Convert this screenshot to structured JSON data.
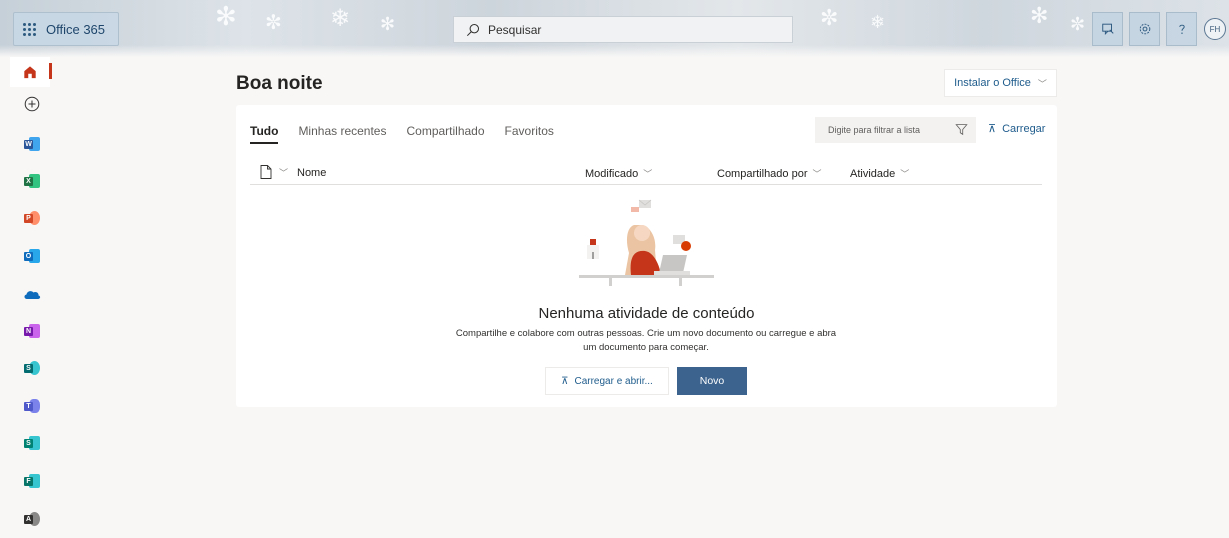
{
  "topbar": {
    "app_title": "Office 365",
    "search_placeholder": "Pesquisar",
    "avatar_initials": "FH"
  },
  "rail": {
    "items": [
      {
        "name": "home",
        "letter": "",
        "color": "#c4351a"
      },
      {
        "name": "create",
        "letter": "",
        "color": "#323130"
      },
      {
        "name": "word",
        "letter": "W",
        "color": "#2b579a"
      },
      {
        "name": "excel",
        "letter": "X",
        "color": "#217346"
      },
      {
        "name": "powerpoint",
        "letter": "P",
        "color": "#d24726"
      },
      {
        "name": "outlook",
        "letter": "O",
        "color": "#0f6cbd"
      },
      {
        "name": "onedrive",
        "letter": "",
        "color": "#0f6cbd"
      },
      {
        "name": "onenote",
        "letter": "N",
        "color": "#7719aa"
      },
      {
        "name": "sharepoint",
        "letter": "S",
        "color": "#036c70"
      },
      {
        "name": "teams",
        "letter": "T",
        "color": "#5059c9"
      },
      {
        "name": "sway",
        "letter": "S",
        "color": "#008272"
      },
      {
        "name": "forms",
        "letter": "F",
        "color": "#077568"
      },
      {
        "name": "admin",
        "letter": "A",
        "color": "#323130"
      }
    ]
  },
  "main": {
    "greeting": "Boa noite",
    "install_label": "Instalar o Office",
    "tabs": [
      "Tudo",
      "Minhas recentes",
      "Compartilhado",
      "Favoritos"
    ],
    "active_tab": "Tudo",
    "filter_placeholder": "Digite para filtrar a lista",
    "upload_link": "Carregar",
    "columns": {
      "name": "Nome",
      "modified": "Modificado",
      "shared_by": "Compartilhado por",
      "activity": "Atividade"
    },
    "empty": {
      "title": "Nenhuma atividade de conteúdo",
      "description": "Compartilhe e colabore com outras pessoas. Crie um novo documento ou carregue e abra um documento para começar.",
      "upload_button": "Carregar e abrir...",
      "new_button": "Novo"
    }
  },
  "colors": {
    "accent": "#3c638e",
    "link": "#1f5c8c",
    "active_marker": "#c4351a",
    "page_bg": "#f8f7f6"
  }
}
